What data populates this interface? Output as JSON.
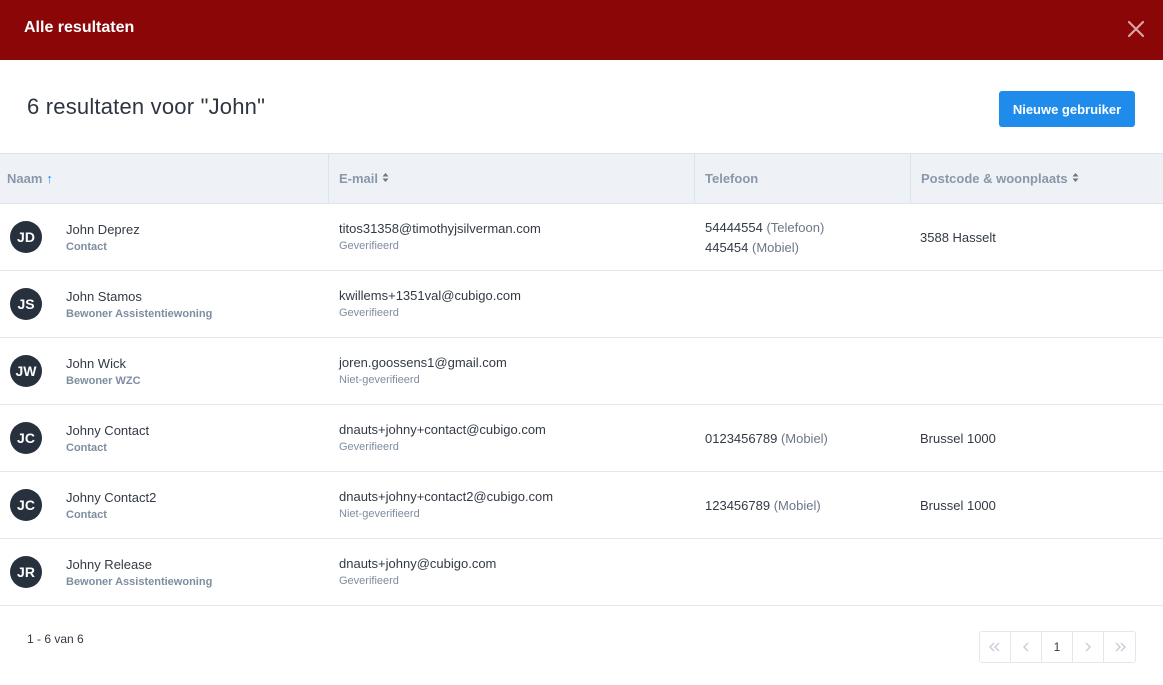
{
  "modal": {
    "title": "Alle resultaten"
  },
  "heading": "6 resultaten voor \"John\"",
  "new_user_label": "Nieuwe gebruiker",
  "columns": {
    "name": "Naam",
    "email": "E-mail",
    "phone": "Telefoon",
    "postal": "Postcode & woonplaats"
  },
  "rows": [
    {
      "initials": "JD",
      "name": "John Deprez",
      "role": "Contact",
      "email": "titos31358@timothyjsilverman.com",
      "verification": "Geverifieerd",
      "phones": [
        {
          "number": "54444554",
          "type": "(Telefoon)"
        },
        {
          "number": "445454",
          "type": "(Mobiel)"
        }
      ],
      "city": "3588 Hasselt"
    },
    {
      "initials": "JS",
      "name": "John Stamos",
      "role": "Bewoner Assistentiewoning",
      "email": "kwillems+1351val@cubigo.com",
      "verification": "Geverifieerd",
      "phones": [],
      "city": ""
    },
    {
      "initials": "JW",
      "name": "John Wick",
      "role": "Bewoner WZC",
      "email": "joren.goossens1@gmail.com",
      "verification": "Niet-geverifieerd",
      "phones": [],
      "city": ""
    },
    {
      "initials": "JC",
      "name": "Johny Contact",
      "role": "Contact",
      "email": "dnauts+johny+contact@cubigo.com",
      "verification": "Geverifieerd",
      "phones": [
        {
          "number": "0123456789",
          "type": "(Mobiel)"
        }
      ],
      "city": "Brussel 1000"
    },
    {
      "initials": "JC",
      "name": "Johny Contact2",
      "role": "Contact",
      "email": "dnauts+johny+contact2@cubigo.com",
      "verification": "Niet-geverifieerd",
      "phones": [
        {
          "number": "123456789",
          "type": "(Mobiel)"
        }
      ],
      "city": "Brussel 1000"
    },
    {
      "initials": "JR",
      "name": "Johny Release",
      "role": "Bewoner Assistentiewoning",
      "email": "dnauts+johny@cubigo.com",
      "verification": "Geverifieerd",
      "phones": [],
      "city": ""
    }
  ],
  "pagination": {
    "summary": "1 - 6 van 6",
    "current_page": "1"
  },
  "icons": {
    "close": "close-icon",
    "sort_asc": "arrow-up-icon",
    "sort_both": "sort-icon",
    "first": "double-chevron-left-icon",
    "prev": "chevron-left-icon",
    "next": "chevron-right-icon",
    "last": "double-chevron-right-icon"
  },
  "colors": {
    "header_bg": "#8b0707",
    "primary_button": "#1f8ceb",
    "avatar_bg": "#27303d",
    "table_head_bg": "#eef2f7"
  }
}
